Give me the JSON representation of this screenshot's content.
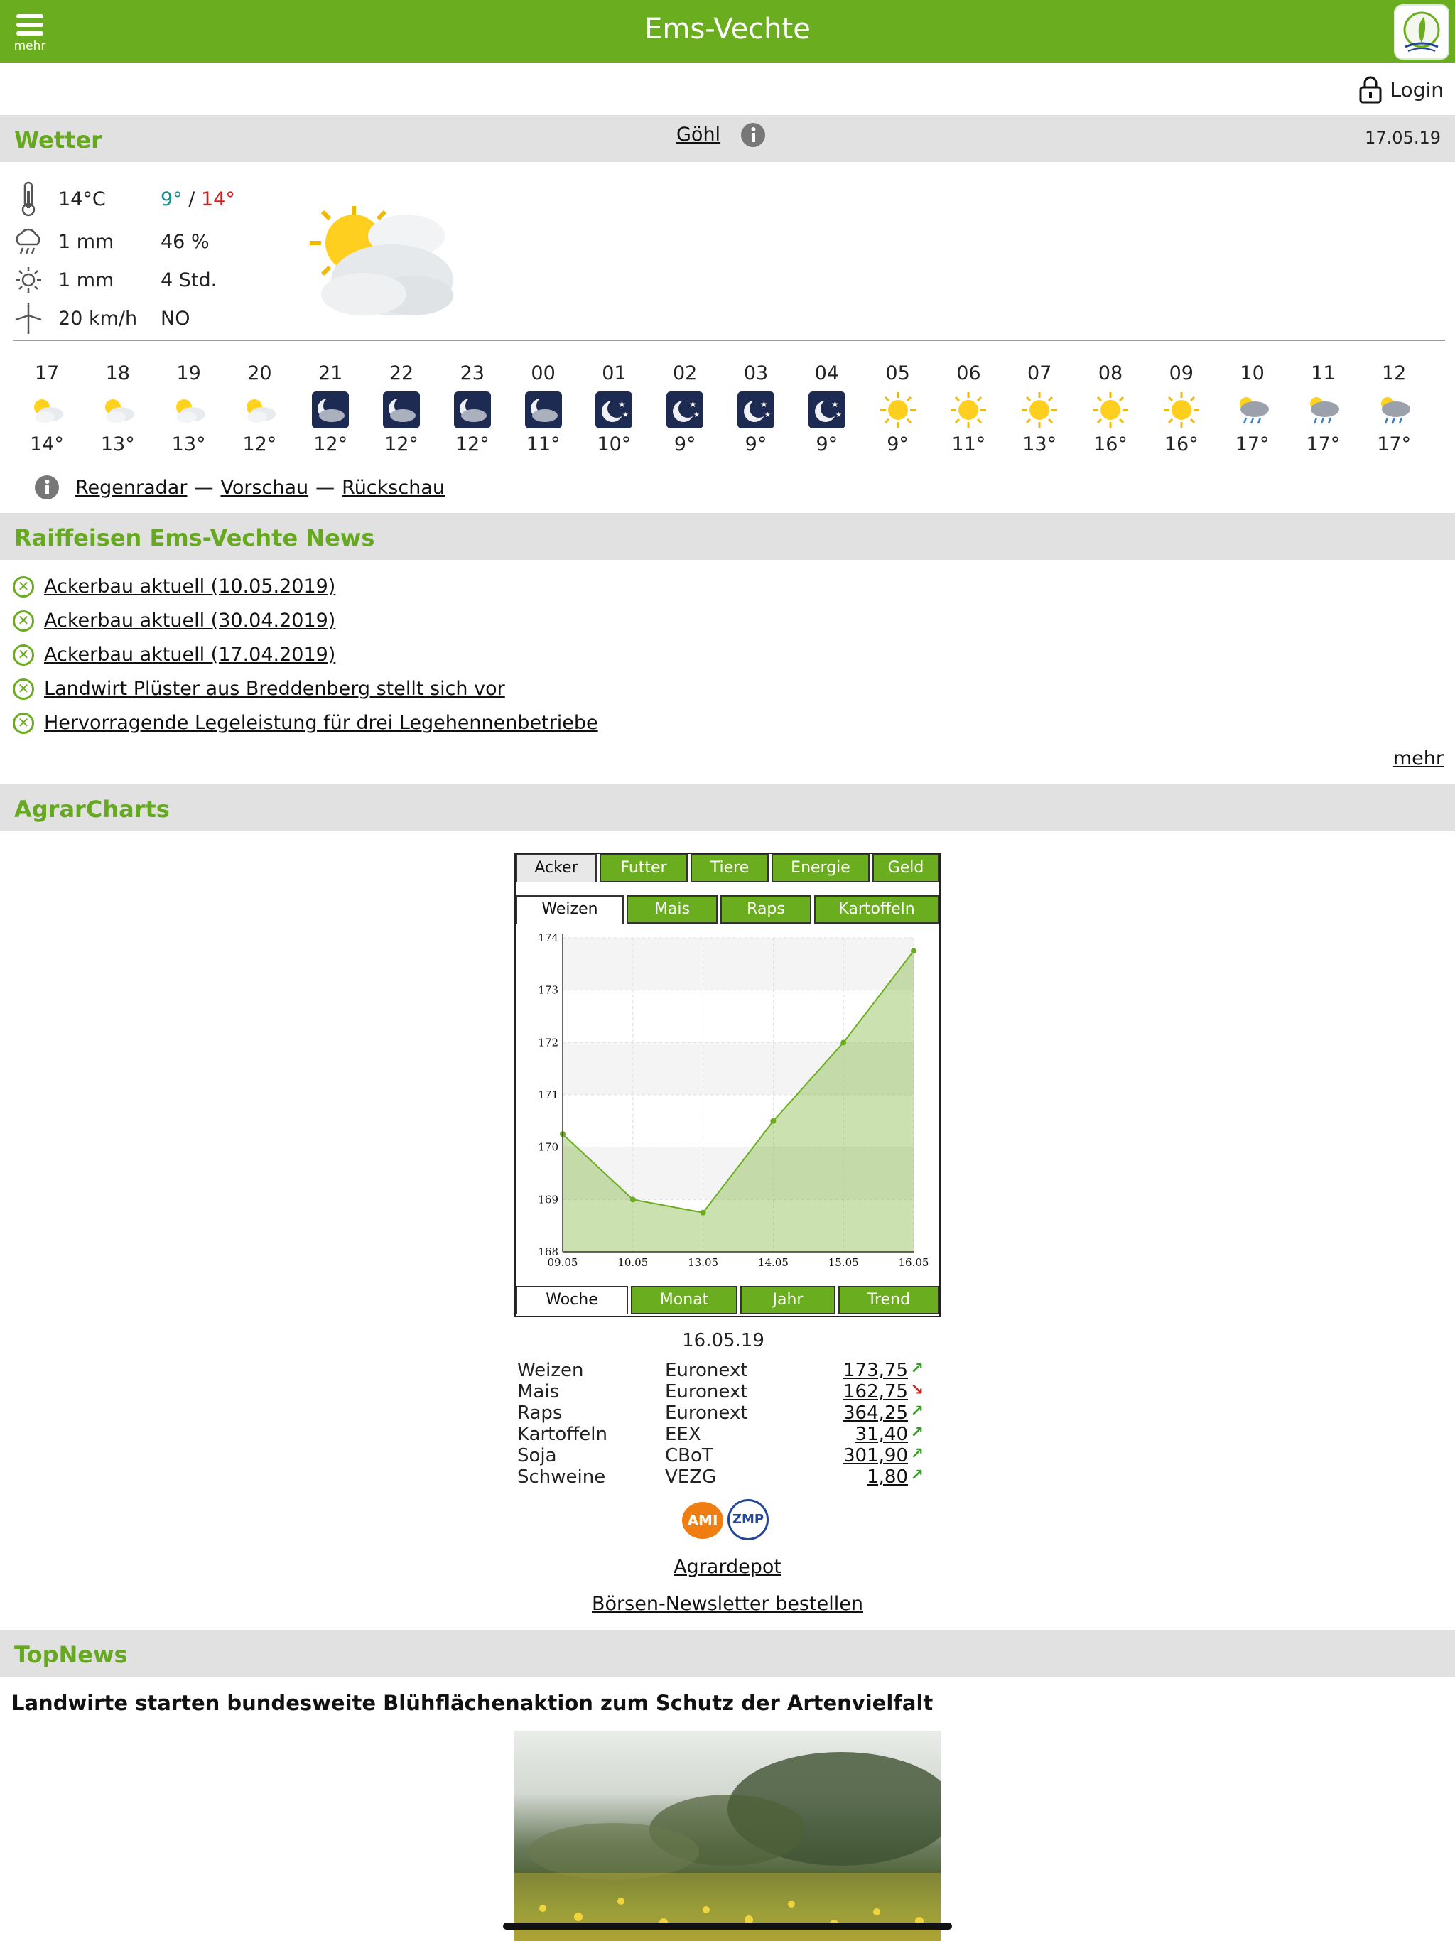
{
  "header": {
    "menu_label": "mehr",
    "title": "Ems-Vechte",
    "login_label": "Login"
  },
  "weather": {
    "section_title": "Wetter",
    "location": "Göhl",
    "date": "17.05.19",
    "temp": "14°C",
    "min": "9°",
    "slash": "/",
    "max": "14°",
    "rain": "1 mm",
    "rain_prob": "46 %",
    "sun_mm": "1 mm",
    "sun_hours": "4 Std.",
    "wind": "20 km/h",
    "wind_dir": "NO",
    "hourly": [
      {
        "h": "17",
        "t": "14°",
        "icon": "partly-cloudy-icon"
      },
      {
        "h": "18",
        "t": "13°",
        "icon": "partly-cloudy-icon"
      },
      {
        "h": "19",
        "t": "13°",
        "icon": "partly-cloudy-icon"
      },
      {
        "h": "20",
        "t": "12°",
        "icon": "partly-cloudy-icon"
      },
      {
        "h": "21",
        "t": "12°",
        "icon": "night-cloudy-icon"
      },
      {
        "h": "22",
        "t": "12°",
        "icon": "night-cloudy-icon"
      },
      {
        "h": "23",
        "t": "12°",
        "icon": "night-cloudy-icon"
      },
      {
        "h": "00",
        "t": "11°",
        "icon": "night-cloudy-icon"
      },
      {
        "h": "01",
        "t": "10°",
        "icon": "night-clear-icon"
      },
      {
        "h": "02",
        "t": "9°",
        "icon": "night-clear-icon"
      },
      {
        "h": "03",
        "t": "9°",
        "icon": "night-clear-icon"
      },
      {
        "h": "04",
        "t": "9°",
        "icon": "night-clear-icon"
      },
      {
        "h": "05",
        "t": "9°",
        "icon": "sun-icon"
      },
      {
        "h": "06",
        "t": "11°",
        "icon": "sun-icon"
      },
      {
        "h": "07",
        "t": "13°",
        "icon": "sun-icon"
      },
      {
        "h": "08",
        "t": "16°",
        "icon": "sun-icon"
      },
      {
        "h": "09",
        "t": "16°",
        "icon": "sun-icon"
      },
      {
        "h": "10",
        "t": "17°",
        "icon": "rain-cloud-icon"
      },
      {
        "h": "11",
        "t": "17°",
        "icon": "rain-cloud-icon"
      },
      {
        "h": "12",
        "t": "17°",
        "icon": "rain-cloud-icon"
      }
    ],
    "links": {
      "radar": "Regenradar",
      "sep1": "—",
      "forecast": "Vorschau",
      "sep2": "—",
      "review": "Rückschau"
    }
  },
  "news": {
    "section_title": "Raiffeisen Ems-Vechte News",
    "items": [
      "Ackerbau aktuell (10.05.2019)",
      "Ackerbau aktuell (30.04.2019)",
      "Ackerbau aktuell (17.04.2019)",
      "Landwirt Plüster aus Breddenberg stellt sich vor",
      "Hervorragende Legeleistung für drei Legehennenbetriebe"
    ],
    "more": "mehr"
  },
  "charts": {
    "section_title": "AgrarCharts",
    "category_tabs": [
      "Acker",
      "Futter",
      "Tiere",
      "Energie",
      "Geld"
    ],
    "product_tabs": [
      "Weizen",
      "Mais",
      "Raps",
      "Kartoffeln"
    ],
    "period_tabs": [
      "Woche",
      "Monat",
      "Jahr",
      "Trend"
    ],
    "quote_date": "16.05.19",
    "quotes": [
      {
        "name": "Weizen",
        "market": "Euronext",
        "price": "173,75",
        "dir": "up"
      },
      {
        "name": "Mais",
        "market": "Euronext",
        "price": "162,75",
        "dir": "down"
      },
      {
        "name": "Raps",
        "market": "Euronext",
        "price": "364,25",
        "dir": "up"
      },
      {
        "name": "Kartoffeln",
        "market": "EEX",
        "price": "31,40",
        "dir": "up"
      },
      {
        "name": "Soja",
        "market": "CBoT",
        "price": "301,90",
        "dir": "up"
      },
      {
        "name": "Schweine",
        "market": "VEZG",
        "price": "1,80",
        "dir": "up"
      }
    ],
    "ami_label": "AMI",
    "zmp_label": "ZMP",
    "agrardepot": "Agrardepot",
    "newsletter": "Börsen-Newsletter bestellen"
  },
  "chart_data": {
    "type": "area",
    "x": [
      "09.05",
      "10.05",
      "13.05",
      "14.05",
      "15.05",
      "16.05"
    ],
    "values": [
      170.25,
      169.0,
      168.75,
      170.5,
      172.0,
      173.75
    ],
    "ylim": [
      168,
      174
    ],
    "yticks": [
      168,
      169,
      170,
      171,
      172,
      173,
      174
    ],
    "grid": true,
    "color": "#6aad1e"
  },
  "topnews": {
    "section_title": "TopNews",
    "headline": "Landwirte starten bundesweite Blühflächenaktion zum Schutz der Artenvielfalt"
  },
  "colors": {
    "brand": "#6aad1e",
    "section_bg": "#e1e1e1",
    "min_temp": "#1a8a8a",
    "max_temp": "#d21d1d"
  }
}
